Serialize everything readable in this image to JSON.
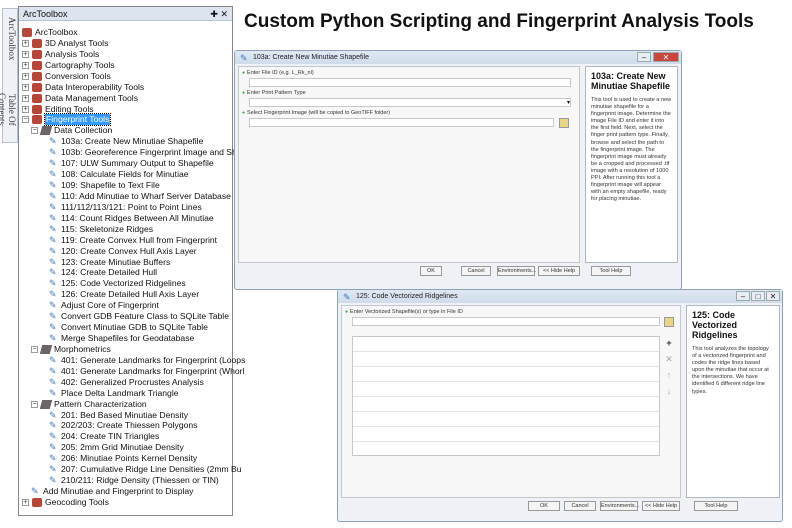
{
  "heading": "Custom Python Scripting and Fingerprint Analysis Tools",
  "side_tabs": [
    "ArcToolbox",
    "Table Of Contents"
  ],
  "toolbox": {
    "title": "ArcToolbox",
    "pin": "✚",
    "close": "✕",
    "rows": [
      {
        "label": "ArcToolbox",
        "level": 0,
        "type": "root"
      },
      {
        "label": "3D Analyst Tools",
        "level": 1,
        "type": "box"
      },
      {
        "label": "Analysis Tools",
        "level": 1,
        "type": "box"
      },
      {
        "label": "Cartography Tools",
        "level": 1,
        "type": "box"
      },
      {
        "label": "Conversion Tools",
        "level": 1,
        "type": "box"
      },
      {
        "label": "Data Interoperability Tools",
        "level": 1,
        "type": "box"
      },
      {
        "label": "Data Management Tools",
        "level": 1,
        "type": "box"
      },
      {
        "label": "Editing Tools",
        "level": 1,
        "type": "box"
      },
      {
        "label": "Fingerprint Tools",
        "level": 1,
        "type": "box",
        "selected": true
      },
      {
        "label": "Data Collection",
        "level": 2,
        "type": "set"
      },
      {
        "label": "103a: Create New Minutiae Shapefile",
        "level": 3,
        "type": "script"
      },
      {
        "label": "103b: Georeference Fingerprint Image and Shap",
        "level": 3,
        "type": "script"
      },
      {
        "label": "107: ULW Summary Output to Shapefile",
        "level": 3,
        "type": "script"
      },
      {
        "label": "108: Calculate Fields for Minutiae",
        "level": 3,
        "type": "script"
      },
      {
        "label": "109: Shapefile to Text File",
        "level": 3,
        "type": "script"
      },
      {
        "label": "110: Add Minutiae to Wharf Server Database",
        "level": 3,
        "type": "script"
      },
      {
        "label": "111/112/113/121: Point to Point Lines",
        "level": 3,
        "type": "script"
      },
      {
        "label": "114: Count Ridges Between All Minutiae",
        "level": 3,
        "type": "script"
      },
      {
        "label": "115: Skeletonize Ridges",
        "level": 3,
        "type": "script"
      },
      {
        "label": "119: Create Convex Hull from Fingerprint",
        "level": 3,
        "type": "script"
      },
      {
        "label": "120: Create Convex Hull Axis Layer",
        "level": 3,
        "type": "script"
      },
      {
        "label": "123: Create Minutiae Buffers",
        "level": 3,
        "type": "script"
      },
      {
        "label": "124: Create Detailed Hull",
        "level": 3,
        "type": "script"
      },
      {
        "label": "125: Code Vectorized Ridgelines",
        "level": 3,
        "type": "script"
      },
      {
        "label": "126: Create Detailed Hull Axis Layer",
        "level": 3,
        "type": "script"
      },
      {
        "label": "Adjust Core of Fingerprint",
        "level": 3,
        "type": "script"
      },
      {
        "label": "Convert GDB Feature Class to SQLite Table",
        "level": 3,
        "type": "script"
      },
      {
        "label": "Convert Minutiae GDB to SQLite Table",
        "level": 3,
        "type": "script"
      },
      {
        "label": "Merge Shapefiles for Geodatabase",
        "level": 3,
        "type": "script"
      },
      {
        "label": "Morphometrics",
        "level": 2,
        "type": "set"
      },
      {
        "label": "401: Generate Landmarks for Fingerprint (Loops",
        "level": 3,
        "type": "script"
      },
      {
        "label": "401: Generate Landmarks for Fingerprint (Whorl",
        "level": 3,
        "type": "script"
      },
      {
        "label": "402: Generalized Procrustes Analysis",
        "level": 3,
        "type": "script"
      },
      {
        "label": "Place Delta Landmark Triangle",
        "level": 3,
        "type": "script"
      },
      {
        "label": "Pattern Characterization",
        "level": 2,
        "type": "set"
      },
      {
        "label": "201: Bed Based Minutiae Density",
        "level": 3,
        "type": "script"
      },
      {
        "label": "202/203: Create Thiessen Polygons",
        "level": 3,
        "type": "script"
      },
      {
        "label": "204: Create TIN Triangles",
        "level": 3,
        "type": "script"
      },
      {
        "label": "205: 2mm Grid Minutiae Density",
        "level": 3,
        "type": "script"
      },
      {
        "label": "206: Minutiae Points Kernel Density",
        "level": 3,
        "type": "script"
      },
      {
        "label": "207: Cumulative Ridge Line Densities (2mm Bu",
        "level": 3,
        "type": "script"
      },
      {
        "label": "210/211: Ridge Density (Thiessen or TIN)",
        "level": 3,
        "type": "script"
      },
      {
        "label": "Add Minutiae and Fingerprint to Display",
        "level": 2,
        "type": "script"
      },
      {
        "label": "Geocoding Tools",
        "level": 1,
        "type": "box"
      }
    ]
  },
  "dialog1": {
    "title": "103a: Create New Minutiae Shapefile",
    "fields": [
      "Enter File ID (e.g. L_Rk_nl)",
      "Enter Print Pattern Type",
      "Select Fingerprint Image (will be copied to GeoTIFF folder)"
    ],
    "help_title": "103a: Create New Minutiae Shapefile",
    "help_text": "This tool is used to create a new minutiae shapefile for a fingerprint image. Determine the image File ID and enter it into the first field. Next, select the finger print pattern type. Finally, browse and select the path to the fingerprint image. The fingerprint image must already be a cropped and processed .tif image with a resolution of 1000 PPI. After running this tool a fingerprint image will appear with an empty shapefile, ready for placing minutiae.",
    "buttons": [
      "OK",
      "Cancel",
      "Environments...",
      "<< Hide Help",
      "Tool Help"
    ]
  },
  "dialog2": {
    "title": "125: Code Vectorized Ridgelines",
    "fields": [
      "Enter Vectorized Shapefile(s) or type in File ID"
    ],
    "help_title": "125: Code Vectorized Ridgelines",
    "help_text": "This tool analyzes the topology of a vectorized fingerprint and codes the ridge lines based upon the minutiae that occur at the intersections. We have identified 6 different ridge line types.",
    "buttons": [
      "OK",
      "Cancel",
      "Environments...",
      "<< Hide Help",
      "Tool Help"
    ]
  }
}
